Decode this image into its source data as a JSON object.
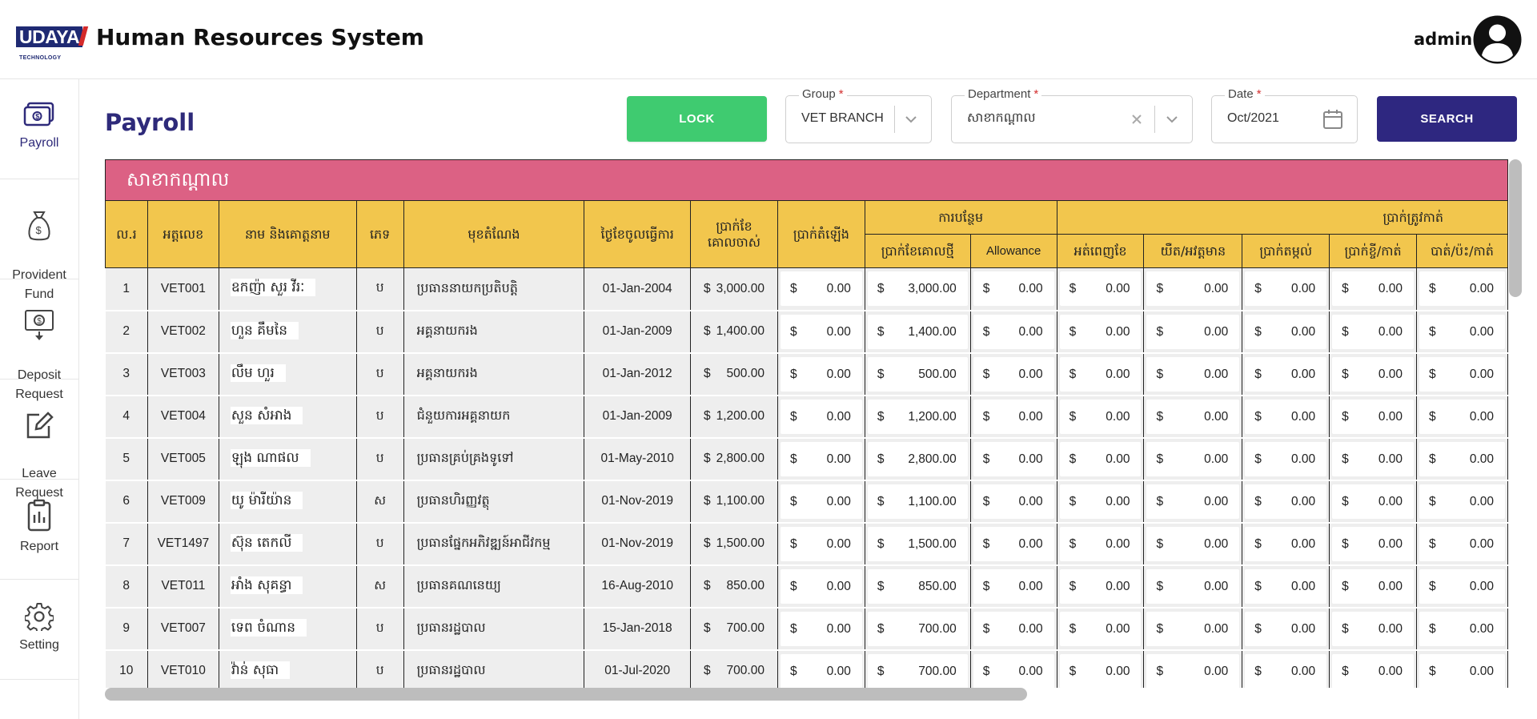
{
  "header": {
    "logo_text": "UDAYA",
    "logo_subtext": "TECHNOLOGY",
    "title": "Human Resources System",
    "user_name": "admin"
  },
  "sidebar": {
    "items": [
      {
        "label": "Payroll",
        "icon": "payroll-icon"
      },
      {
        "label": "Provident\nFund",
        "icon": "money-bag-icon"
      },
      {
        "label": "Deposit\nRequest",
        "icon": "deposit-icon"
      },
      {
        "label": "Leave\nRequest",
        "icon": "edit-icon"
      },
      {
        "label": "Report",
        "icon": "clipboard-icon"
      },
      {
        "label": "Setting",
        "icon": "gear-icon"
      }
    ]
  },
  "toolbar": {
    "page_title": "Payroll",
    "lock_label": "LOCK",
    "search_label": "SEARCH",
    "group": {
      "label": "Group",
      "required": "*",
      "value": "VET BRANCH"
    },
    "department": {
      "label": "Department",
      "required": "*",
      "value": "សាខាកណ្តាល"
    },
    "date": {
      "label": "Date",
      "required": "*",
      "value": "Oct/2021"
    }
  },
  "table": {
    "banner": "សាខាកណ្តាល",
    "headers": {
      "no": "ល.រ",
      "id": "អត្តលេខ",
      "name": "នាម និងគោត្តនាម",
      "gender": "ភេទ",
      "position": "មុខតំណែង",
      "start_date": "ថ្ងៃខែចូលធ្វើការ",
      "old_base": "ប្រាក់ខែ\nគោលចាស់",
      "raise": "ប្រាក់តំឡើង",
      "addition_group": "ការបន្ថែម",
      "new_base": "ប្រាក់ខែគោលថ្មី",
      "allowance": "Allowance",
      "deduction_group": "ប្រាក់ត្រូវកាត់",
      "half_salary": "អត់ពេញខែ",
      "late": "យឺត/អវត្តមាន",
      "savings": "ប្រាក់តម្កល់",
      "loan": "ប្រាក់ខ្ចី/កាត់",
      "damage": "បាត់/ប៉ះ/កាត់"
    },
    "currency": "$",
    "rows": [
      {
        "no": "1",
        "id": "VET001",
        "name": "ឧកញ៉ា សួរ វីរៈ",
        "gender": "ប",
        "position": "ប្រធាននាយកប្រតិបត្តិ",
        "start": "01-Jan-2004",
        "old_base": "3,000.00",
        "raise": "0.00",
        "new_base": "3,000.00",
        "allowance": "0.00",
        "half": "0.00",
        "late": "0.00",
        "savings": "0.00",
        "loan": "0.00",
        "damage": "0.00"
      },
      {
        "no": "2",
        "id": "VET002",
        "name": "ហួន គឹមនៃ",
        "gender": "ប",
        "position": "អគ្គនាយករង",
        "start": "01-Jan-2009",
        "old_base": "1,400.00",
        "raise": "0.00",
        "new_base": "1,400.00",
        "allowance": "0.00",
        "half": "0.00",
        "late": "0.00",
        "savings": "0.00",
        "loan": "0.00",
        "damage": "0.00"
      },
      {
        "no": "3",
        "id": "VET003",
        "name": "លឹម ហួរ",
        "gender": "ប",
        "position": "អគ្គនាយករង",
        "start": "01-Jan-2012",
        "old_base": "500.00",
        "raise": "0.00",
        "new_base": "500.00",
        "allowance": "0.00",
        "half": "0.00",
        "late": "0.00",
        "savings": "0.00",
        "loan": "0.00",
        "damage": "0.00"
      },
      {
        "no": "4",
        "id": "VET004",
        "name": "សួន សំអាង",
        "gender": "ប",
        "position": "ជំនួយការអគ្គនាយក",
        "start": "01-Jan-2009",
        "old_base": "1,200.00",
        "raise": "0.00",
        "new_base": "1,200.00",
        "allowance": "0.00",
        "half": "0.00",
        "late": "0.00",
        "savings": "0.00",
        "loan": "0.00",
        "damage": "0.00"
      },
      {
        "no": "5",
        "id": "VET005",
        "name": "ឡុង ណាផល",
        "gender": "ប",
        "position": "ប្រធានគ្រប់គ្រងទូទៅ",
        "start": "01-May-2010",
        "old_base": "2,800.00",
        "raise": "0.00",
        "new_base": "2,800.00",
        "allowance": "0.00",
        "half": "0.00",
        "late": "0.00",
        "savings": "0.00",
        "loan": "0.00",
        "damage": "0.00"
      },
      {
        "no": "6",
        "id": "VET009",
        "name": "យូ ម៉ារីយ៉ាន",
        "gender": "ស",
        "position": "ប្រធានហិរញ្ញវត្ថុ",
        "start": "01-Nov-2019",
        "old_base": "1,100.00",
        "raise": "0.00",
        "new_base": "1,100.00",
        "allowance": "0.00",
        "half": "0.00",
        "late": "0.00",
        "savings": "0.00",
        "loan": "0.00",
        "damage": "0.00"
      },
      {
        "no": "7",
        "id": "VET1497",
        "name": "ស៊ុន តេកលី",
        "gender": "ប",
        "position": "ប្រធានផ្នែកអភិវឌ្ឍន៍អាជីវកម្ម",
        "start": "01-Nov-2019",
        "old_base": "1,500.00",
        "raise": "0.00",
        "new_base": "1,500.00",
        "allowance": "0.00",
        "half": "0.00",
        "late": "0.00",
        "savings": "0.00",
        "loan": "0.00",
        "damage": "0.00"
      },
      {
        "no": "8",
        "id": "VET011",
        "name": "អាំង សុគន្ធា",
        "gender": "ស",
        "position": "ប្រធានគណនេយ្យ",
        "start": "16-Aug-2010",
        "old_base": "850.00",
        "raise": "0.00",
        "new_base": "850.00",
        "allowance": "0.00",
        "half": "0.00",
        "late": "0.00",
        "savings": "0.00",
        "loan": "0.00",
        "damage": "0.00"
      },
      {
        "no": "9",
        "id": "VET007",
        "name": "ទេព ចំណាន",
        "gender": "ប",
        "position": "ប្រធានរដ្ឋបាល",
        "start": "15-Jan-2018",
        "old_base": "700.00",
        "raise": "0.00",
        "new_base": "700.00",
        "allowance": "0.00",
        "half": "0.00",
        "late": "0.00",
        "savings": "0.00",
        "loan": "0.00",
        "damage": "0.00"
      },
      {
        "no": "10",
        "id": "VET010",
        "name": "វ៉ាន់ សុធា",
        "gender": "ប",
        "position": "ប្រធានរដ្ឋបាល",
        "start": "01-Jul-2020",
        "old_base": "700.00",
        "raise": "0.00",
        "new_base": "700.00",
        "allowance": "0.00",
        "half": "0.00",
        "late": "0.00",
        "savings": "0.00",
        "loan": "0.00",
        "damage": "0.00"
      }
    ]
  }
}
